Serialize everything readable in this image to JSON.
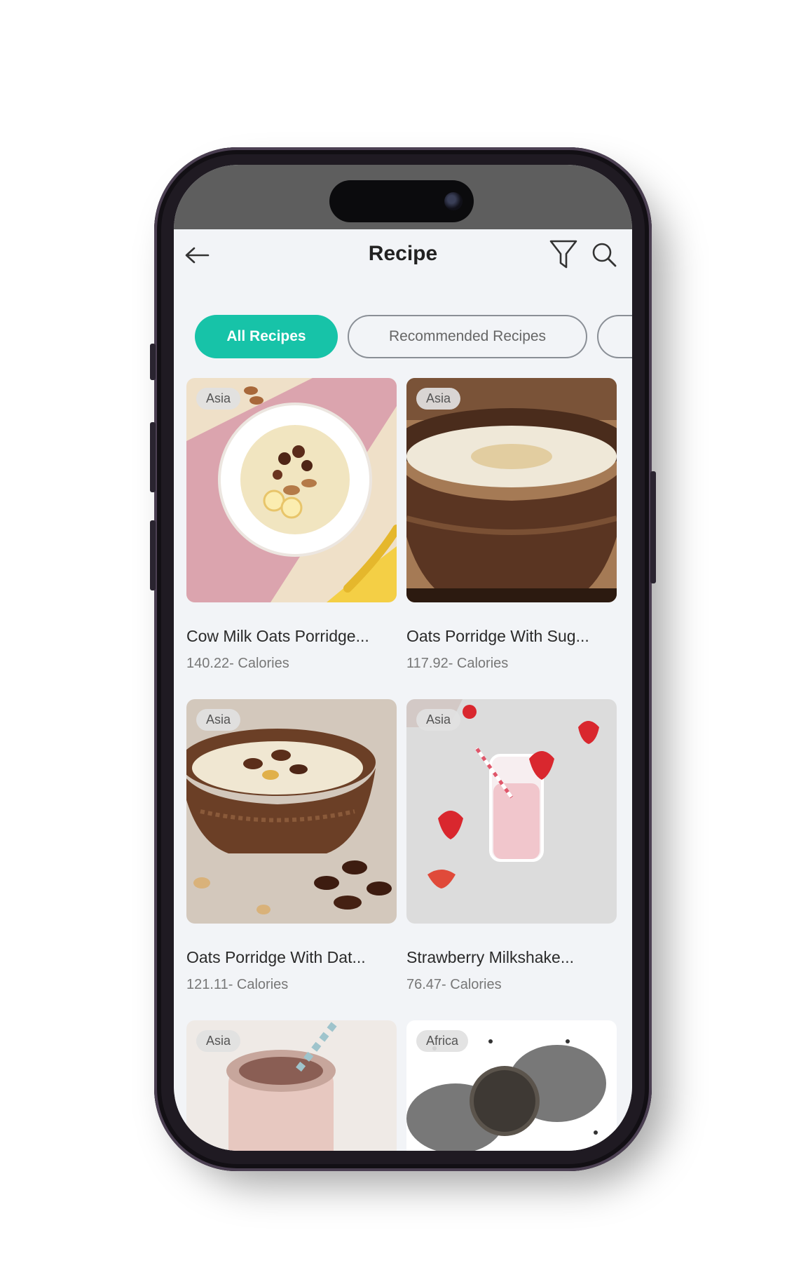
{
  "header": {
    "title": "Recipe"
  },
  "icons": {
    "back": "arrow-left-icon",
    "filter": "funnel-icon",
    "search": "search-icon"
  },
  "colors": {
    "accent": "#17c3a8",
    "background": "#f2f4f7"
  },
  "chips": [
    {
      "label": "All Recipes",
      "active": true
    },
    {
      "label": "Recommended Recipes",
      "active": false
    }
  ],
  "recipes": [
    {
      "region": "Asia",
      "title": "Cow Milk Oats Porridge...",
      "calories": "140.22- Calories"
    },
    {
      "region": "Asia",
      "title": "Oats Porridge With Sug...",
      "calories": "117.92- Calories"
    },
    {
      "region": "Asia",
      "title": "Oats Porridge With Dat...",
      "calories": "121.11- Calories"
    },
    {
      "region": "Asia",
      "title": "Strawberry Milkshake...",
      "calories": "76.47- Calories"
    },
    {
      "region": "Asia",
      "title": "",
      "calories": ""
    },
    {
      "region": "Africa",
      "title": "",
      "calories": ""
    }
  ]
}
